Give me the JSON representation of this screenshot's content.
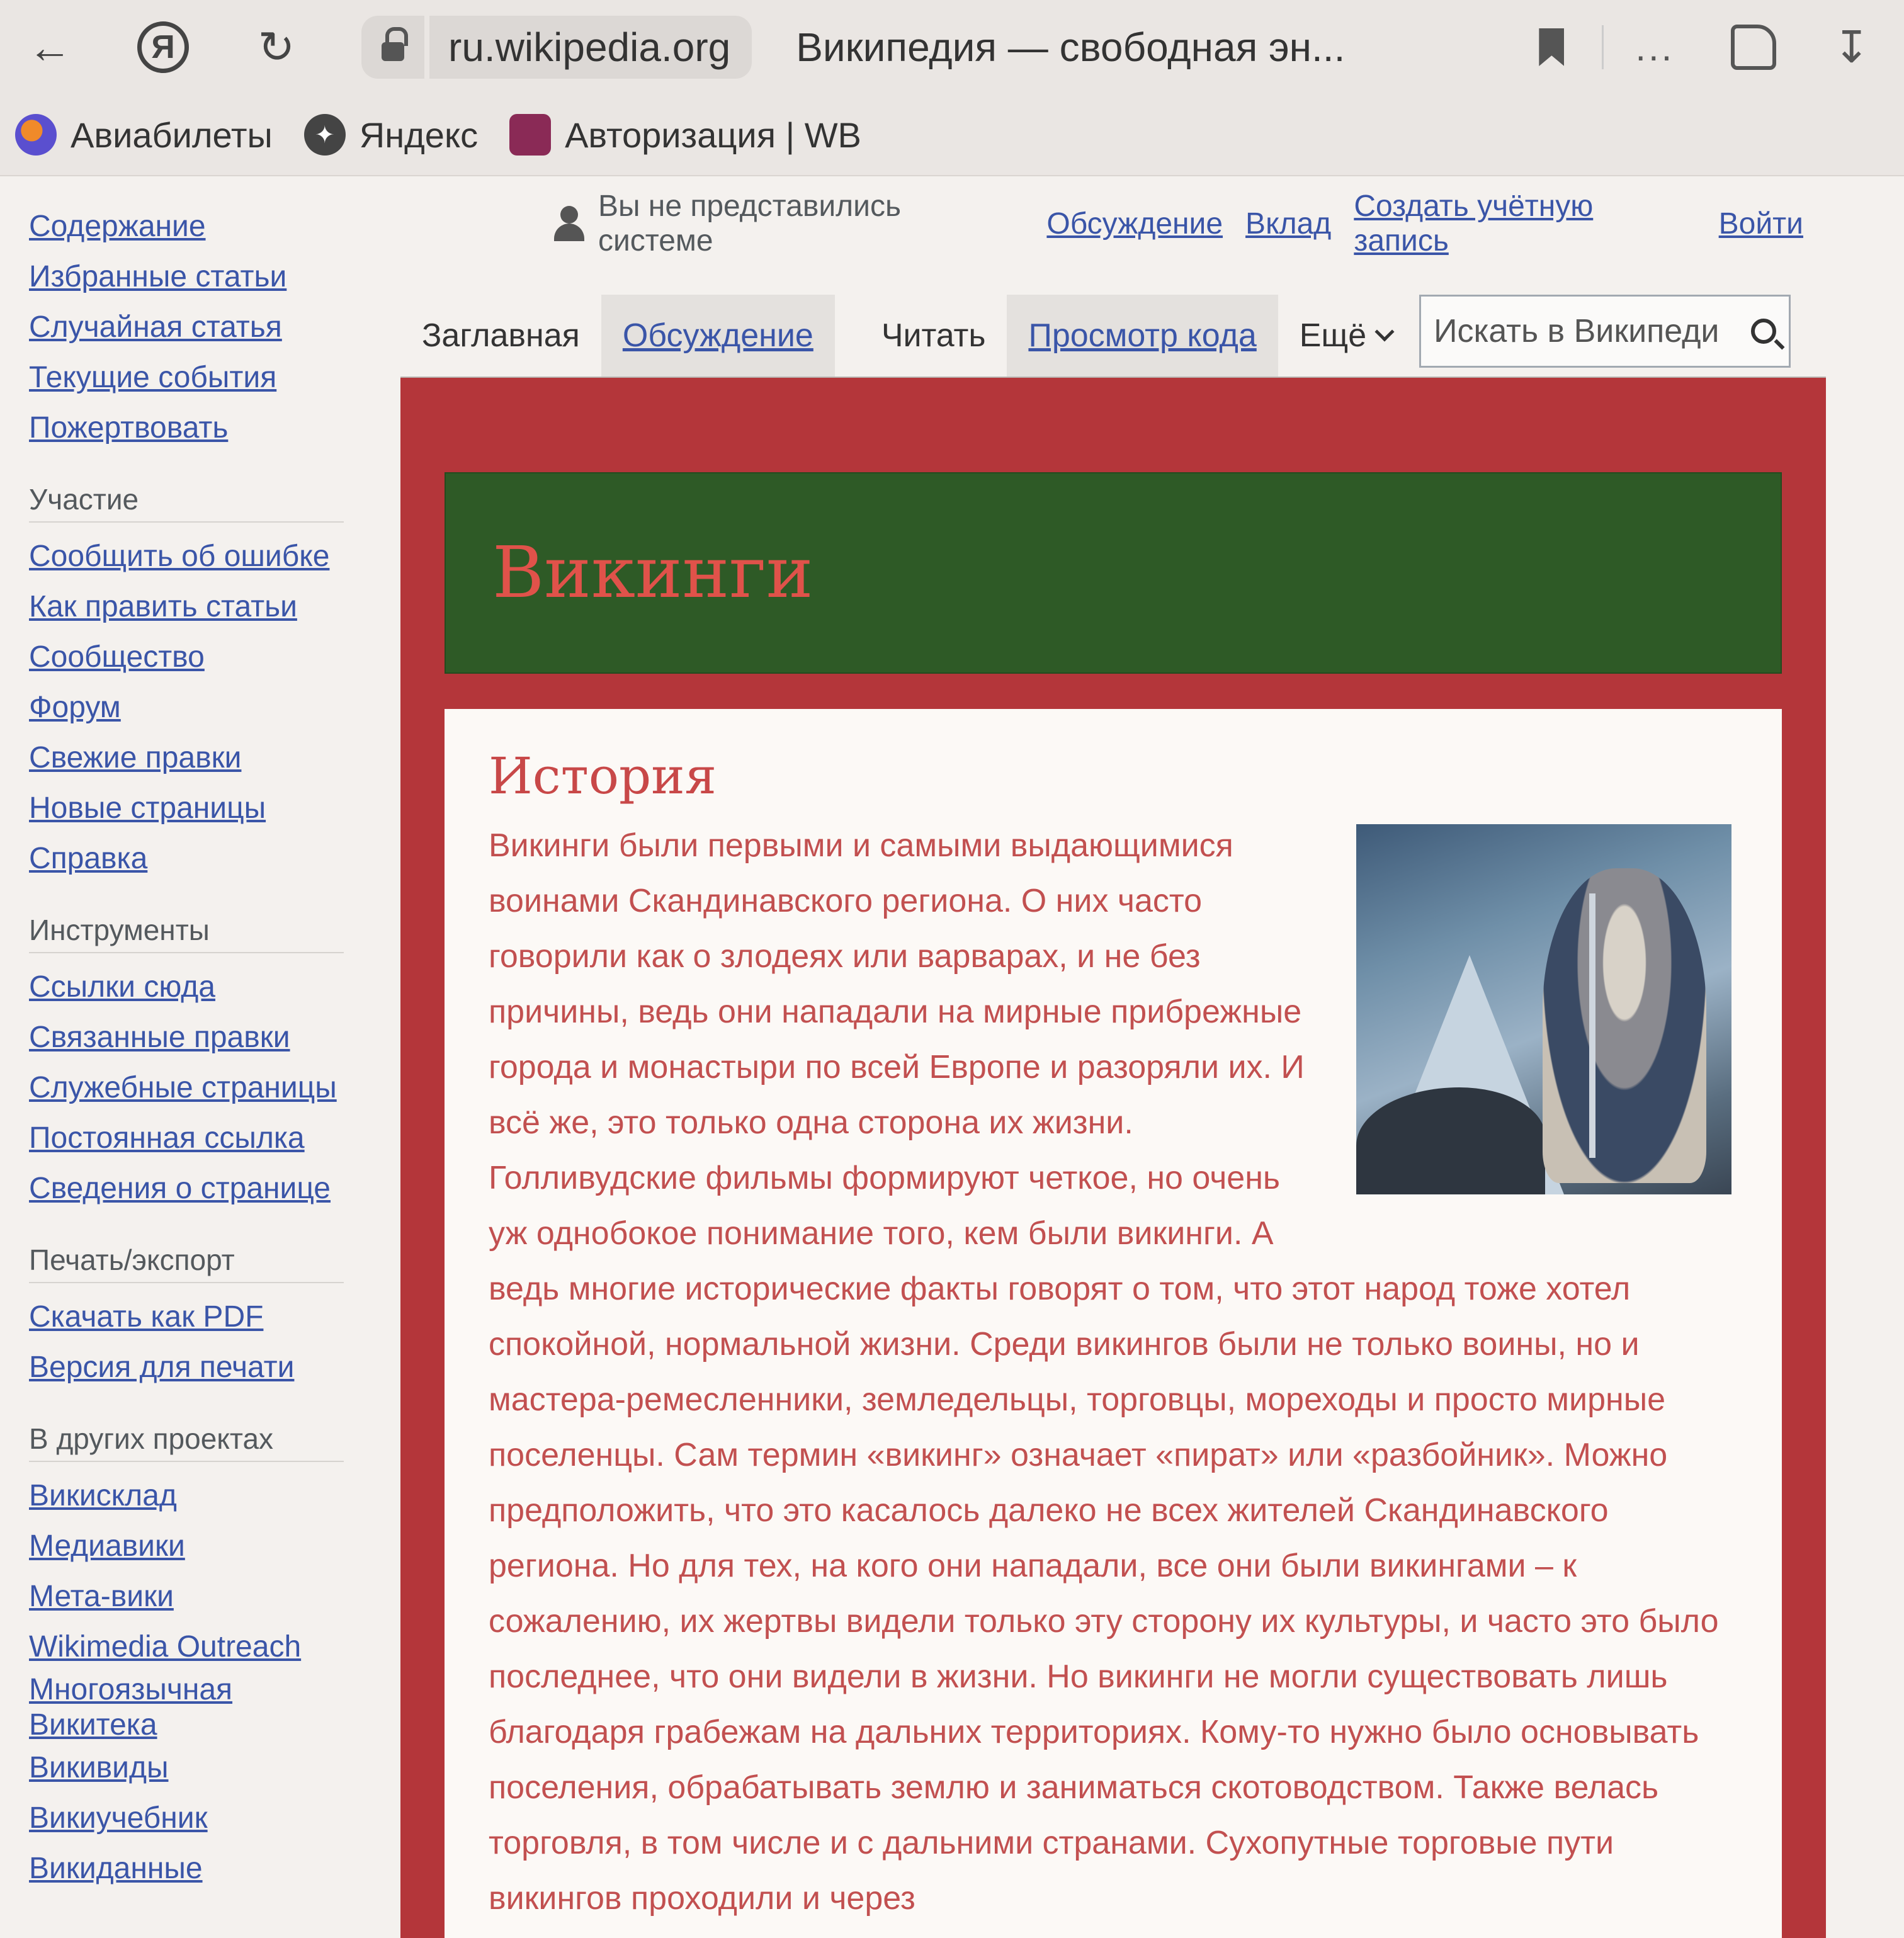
{
  "browser": {
    "url": "ru.wikipedia.org",
    "tab_title": "Википедия — свободная эн...",
    "more": "...",
    "bookmarks": [
      "Авиабилеты",
      "Яндекс",
      "Авторизация | WB"
    ]
  },
  "sidebar": {
    "main": [
      "Содержание",
      "Избранные статьи",
      "Случайная статья",
      "Текущие события",
      "Пожертвовать"
    ],
    "participation_title": "Участие",
    "participation": [
      "Сообщить об ошибке",
      "Как править статьи",
      "Сообщество",
      "Форум",
      "Свежие правки",
      "Новые страницы",
      "Справка"
    ],
    "tools_title": "Инструменты",
    "tools": [
      "Ссылки сюда",
      "Связанные правки",
      "Служебные страницы",
      "Постоянная ссылка",
      "Сведения о странице"
    ],
    "print_title": "Печать/экспорт",
    "print": [
      "Скачать как PDF",
      "Версия для печати"
    ],
    "projects_title": "В других проектах",
    "projects": [
      "Викисклад",
      "Медиавики",
      "Мета-вики",
      "Wikimedia Outreach",
      "Многоязычная Викитека",
      "Викивиды",
      "Викиучебник",
      "Викиданные"
    ]
  },
  "user": {
    "status": "Вы не представились системе",
    "links": [
      "Обсуждение",
      "Вклад",
      "Создать учётную запись",
      "Войти"
    ]
  },
  "tabs": {
    "main": "Заглавная",
    "talk": "Обсуждение",
    "read": "Читать",
    "view_source": "Просмотр кода",
    "more": "Ещё",
    "search_placeholder": "Искать в Википеди"
  },
  "article": {
    "title": "Викинги",
    "section": "История",
    "text": "Викинги были первыми и самыми выдающимися воинами Скандинавского региона. О них часто говорили как о злодеях или варварах, и не без причины, ведь они нападали на мирные прибрежные города и монастыри по всей Европе и разоряли их. И всё же, это только одна сторона их жизни. Голливудские фильмы формируют четкое, но очень уж однобокое понимание того, кем были викинги. А ведь многие исторические факты говорят о том, что этот народ тоже хотел спокойной, нормальной жизни. Среди викингов были не только воины, но и мастера-ремесленники, земледельцы, торговцы, мореходы и просто мирные поселенцы. Сам термин «викинг» означает «пират» или «разбойник». Можно предположить, что это касалось далеко не всех жителей Скандинавского региона. Но для тех, на кого они нападали, все они были викингами – к сожалению, их жертвы видели только эту сторону их культуры, и часто это было последнее, что они видели в жизни. Но викинги не могли существовать лишь благодаря грабежам на дальних территориях. Кому-то нужно было основывать поселения, обрабатывать землю и заниматься скотоводством. Также велась торговля, в том числе и с дальними странами. Сухопутные торговые пути викингов проходили и через"
  }
}
